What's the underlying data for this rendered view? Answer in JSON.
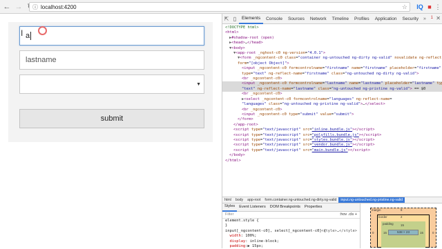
{
  "browser": {
    "url": "localhost:4200",
    "back_icon": "arrow-left-icon",
    "forward_icon": "arrow-right-icon",
    "reload_icon": "reload-icon",
    "info_icon": "info-icon",
    "star_icon": "star-icon",
    "ext1": "IQ"
  },
  "form": {
    "firstname_value": "a",
    "lastname_placeholder": "lastname",
    "submit_label": "submit"
  },
  "devtools": {
    "tabs": [
      "Elements",
      "Console",
      "Sources",
      "Network",
      "Timeline",
      "Profiles",
      "Application",
      "Security"
    ],
    "active_tab": "Elements",
    "more": "»",
    "error_count": "1",
    "dom_lines": [
      {
        "indent": 0,
        "html": "<span class=\"cm\">&lt;!DOCTYPE html&gt;</span>"
      },
      {
        "indent": 0,
        "html": "<span class=\"tag\">&lt;html&gt;</span>"
      },
      {
        "indent": 1,
        "html": "<span class=\"tri\">▶</span><span class=\"tag\">#shadow-root (open)</span>"
      },
      {
        "indent": 1,
        "html": "<span class=\"tri\">▶</span><span class=\"tag\">&lt;head&gt;</span>…<span class=\"tag\">&lt;/head&gt;</span>"
      },
      {
        "indent": 1,
        "html": "<span class=\"tri\">▼</span><span class=\"tag\">&lt;body&gt;</span>"
      },
      {
        "indent": 2,
        "html": "<span class=\"tri\">▼</span><span class=\"tag\">&lt;app-root</span> <span class=\"attr\">_nghost-c0</span> <span class=\"attr\">ng-version</span>=<span class=\"val\">\"4.0.1\"</span><span class=\"tag\">&gt;</span>"
      },
      {
        "indent": 3,
        "html": "<span class=\"tri\">▼</span><span class=\"tag\">&lt;form</span> <span class=\"attr\">_ngcontent-c0</span> <span class=\"attr\">class</span>=<span class=\"val\">\"container ng-untouched ng-dirty ng-valid\"</span> <span class=\"attr\">novalidate</span> <span class=\"attr\">ng-reflect-</span>"
      },
      {
        "indent": 3,
        "html": "<span class=\"attr\">form</span>=<span class=\"val\">\"[object Object]\"</span><span class=\"tag\">&gt;</span>"
      },
      {
        "indent": 4,
        "html": "<span class=\"tag\">&lt;input</span> <span class=\"attr\">_ngcontent-c0</span> <span class=\"attr\">formcontrolname</span>=<span class=\"val\">\"firstname\"</span> <span class=\"attr\">name</span>=<span class=\"val\">\"firstname\"</span> <span class=\"attr\">placeholder</span>=<span class=\"val\">\"firstname\"</span>"
      },
      {
        "indent": 4,
        "html": "<span class=\"attr\">type</span>=<span class=\"val\">\"text\"</span> <span class=\"attr\">ng-reflect-name</span>=<span class=\"val\">\"firstname\"</span> <span class=\"attr\">class</span>=<span class=\"val\">\"ng-untouched ng-dirty ng-valid\"</span><span class=\"tag\">&gt;</span>"
      },
      {
        "indent": 4,
        "html": "<span class=\"tag\">&lt;br</span> <span class=\"attr\">_ngcontent-c0</span><span class=\"tag\">&gt;</span>"
      },
      {
        "indent": 4,
        "sel": true,
        "html": "<span class=\"tag\">&lt;input</span> <span class=\"attr\">_ngcontent-c0</span> <span class=\"attr\">formcontrolname</span>=<span class=\"val\">\"lastname\"</span> <span class=\"attr\">name</span>=<span class=\"val\">\"lastname\"</span> <span class=\"attr\">placeholder</span>=<span class=\"val\">\"lastname\"</span> <span class=\"attr\">type</span>="
      },
      {
        "indent": 4,
        "sel": true,
        "html": "<span class=\"val\">\"text\"</span> <span class=\"attr\">ng-reflect-name</span>=<span class=\"val\">\"lastname\"</span> <span class=\"attr\">class</span>=<span class=\"val\">\"ng-untouched ng-pristine ng-valid\"</span><span class=\"tag\">&gt;</span> == $0"
      },
      {
        "indent": 4,
        "html": "<span class=\"tag\">&lt;br</span> <span class=\"attr\">_ngcontent-c0</span><span class=\"tag\">&gt;</span>"
      },
      {
        "indent": 4,
        "html": "<span class=\"tri\">▶</span><span class=\"tag\">&lt;select</span> <span class=\"attr\">_ngcontent-c0</span> <span class=\"attr\">formcontrolname</span>=<span class=\"val\">\"languages\"</span> <span class=\"attr\">ng-reflect-name</span>="
      },
      {
        "indent": 4,
        "html": "<span class=\"val\">\"languages\"</span> <span class=\"attr\">class</span>=<span class=\"val\">\"ng-untouched ng-pristine ng-valid\"</span><span class=\"tag\">&gt;</span>…<span class=\"tag\">&lt;/select&gt;</span>"
      },
      {
        "indent": 4,
        "html": "<span class=\"tag\">&lt;br</span> <span class=\"attr\">_ngcontent-c0</span><span class=\"tag\">&gt;</span>"
      },
      {
        "indent": 4,
        "html": "<span class=\"tag\">&lt;input</span> <span class=\"attr\">_ngcontent-c0</span> <span class=\"attr\">type</span>=<span class=\"val\">\"submit\"</span> <span class=\"attr\">value</span>=<span class=\"val\">\"submit\"</span><span class=\"tag\">&gt;</span>"
      },
      {
        "indent": 3,
        "html": "<span class=\"tag\">&lt;/form&gt;</span>"
      },
      {
        "indent": 2,
        "html": "<span class=\"tag\">&lt;/app-root&gt;</span>"
      },
      {
        "indent": 2,
        "html": "<span class=\"tag\">&lt;script</span> <span class=\"attr\">type</span>=<span class=\"val\">\"text/javascript\"</span> <span class=\"attr\">src</span>=<span class=\"val\"><u>\"inline.bundle.js\"</u></span><span class=\"tag\">&gt;&lt;/script&gt;</span>"
      },
      {
        "indent": 2,
        "html": "<span class=\"tag\">&lt;script</span> <span class=\"attr\">type</span>=<span class=\"val\">\"text/javascript\"</span> <span class=\"attr\">src</span>=<span class=\"val\"><u>\"polyfills.bundle.js\"</u></span><span class=\"tag\">&gt;&lt;/script&gt;</span>"
      },
      {
        "indent": 2,
        "html": "<span class=\"tag\">&lt;script</span> <span class=\"attr\">type</span>=<span class=\"val\">\"text/javascript\"</span> <span class=\"attr\">src</span>=<span class=\"val\"><u>\"styles.bundle.js\"</u></span><span class=\"tag\">&gt;&lt;/script&gt;</span>"
      },
      {
        "indent": 2,
        "html": "<span class=\"tag\">&lt;script</span> <span class=\"attr\">type</span>=<span class=\"val\">\"text/javascript\"</span> <span class=\"attr\">src</span>=<span class=\"val\"><u>\"vendor.bundle.js\"</u></span><span class=\"tag\">&gt;&lt;/script&gt;</span>"
      },
      {
        "indent": 2,
        "html": "<span class=\"tag\">&lt;script</span> <span class=\"attr\">type</span>=<span class=\"val\">\"text/javascript\"</span> <span class=\"attr\">src</span>=<span class=\"val\"><u>\"main.bundle.js\"</u></span><span class=\"tag\">&gt;&lt;/script&gt;</span>"
      },
      {
        "indent": 1,
        "html": "<span class=\"tag\">&lt;/body&gt;</span>"
      },
      {
        "indent": 0,
        "html": "<span class=\"tag\">&lt;/html&gt;</span>"
      }
    ],
    "breadcrumbs": [
      "html",
      "body",
      "app-root",
      "form.container.ng-untouched.ng-dirty.ng-valid",
      "input.ng-untouched.ng-pristine.ng-valid"
    ],
    "active_crumb": 4,
    "styles_tabs": [
      "Styles",
      "Event Listeners",
      "DOM Breakpoints",
      "Properties"
    ],
    "filter_placeholder": "Filter",
    "filter_right": ":hov  .cls  +",
    "style_lines": [
      {
        "html": "element.style {"
      },
      {
        "html": "}"
      },
      {
        "html": "input[_ngcontent-c0], select[_ngcontent-c0] {",
        "src": "<style>…</style>"
      },
      {
        "html": "&nbsp;&nbsp;<span class=\"prop\">width</span>: 100%;"
      },
      {
        "html": "&nbsp;&nbsp;<span class=\"prop\">display</span>: inline-block;"
      },
      {
        "html": "&nbsp;&nbsp;<span class=\"prop\">padding</span>:▶ 15px;"
      }
    ],
    "box_model": {
      "margin_label": "margin",
      "margin": "8",
      "border_label": "border",
      "border": "2",
      "padding_label": "padding",
      "padding": "15",
      "content": "538 × 23",
      "side_left": "0",
      "side_right": "0"
    }
  }
}
